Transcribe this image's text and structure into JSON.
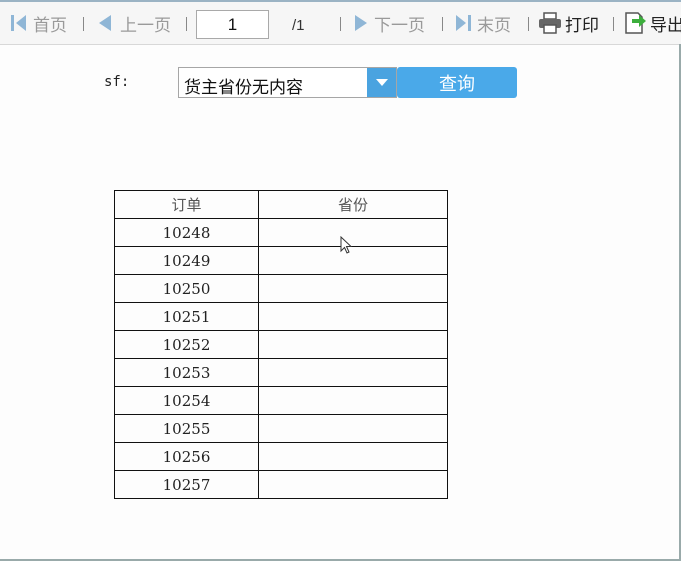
{
  "toolbar": {
    "first_page": "首页",
    "prev_page": "上一页",
    "page_input_value": "1",
    "page_total": "/1",
    "next_page": "下一页",
    "last_page": "末页",
    "print": "打印",
    "export": "导出"
  },
  "filter": {
    "label": "sf:",
    "selected_value": "货主省份无内容",
    "query_button": "查询"
  },
  "table": {
    "headers": [
      "订单",
      "省份"
    ],
    "rows": [
      [
        "10248",
        ""
      ],
      [
        "10249",
        ""
      ],
      [
        "10250",
        ""
      ],
      [
        "10251",
        ""
      ],
      [
        "10252",
        ""
      ],
      [
        "10253",
        ""
      ],
      [
        "10254",
        ""
      ],
      [
        "10255",
        ""
      ],
      [
        "10256",
        ""
      ],
      [
        "10257",
        ""
      ]
    ]
  },
  "colors": {
    "accent": "#4aa9e9",
    "disabled_text": "#9a9a9a",
    "print_icon": "#555555",
    "export_arrow": "#3cae3c"
  }
}
